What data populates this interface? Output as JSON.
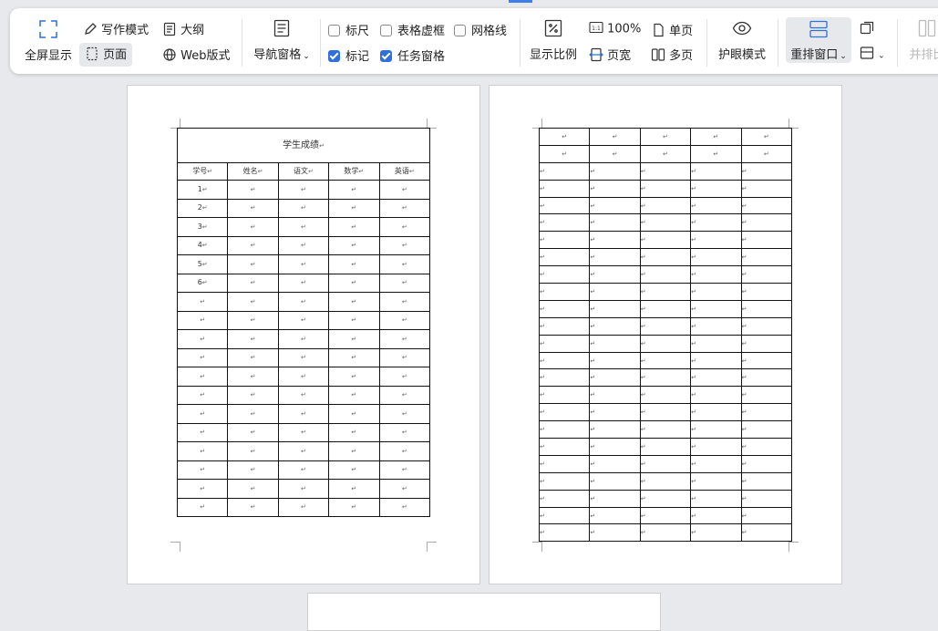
{
  "toolbar": {
    "fullscreen": "全屏显示",
    "writing_mode": "写作模式",
    "outline": "大纲",
    "page": "页面",
    "web_layout": "Web版式",
    "nav_pane": "导航窗格",
    "ruler": "标尺",
    "table_gridlines": "表格虚框",
    "gridlines": "网格线",
    "marks": "标记",
    "task_pane": "任务窗格",
    "zoom_ratio": "显示比例",
    "zoom_100": "100%",
    "page_width": "页宽",
    "single_page": "单页",
    "multi_page": "多页",
    "eye_mode": "护眼模式",
    "rearrange": "重排窗口",
    "side_by_side": "并排比"
  },
  "checkbox_states": {
    "ruler": false,
    "table_gridlines": false,
    "gridlines": false,
    "marks": true,
    "task_pane": true
  },
  "doc": {
    "title": "学生成绩",
    "headers": [
      "学号",
      "姓名",
      "语文",
      "数学",
      "英语"
    ],
    "ids": [
      "1",
      "2",
      "3",
      "4",
      "5",
      "6"
    ],
    "para_mark": "↵"
  },
  "colors": {
    "accent": "#2f6fdf",
    "ribbon_bg": "#ffffff",
    "workspace": "#e7e9ec"
  }
}
